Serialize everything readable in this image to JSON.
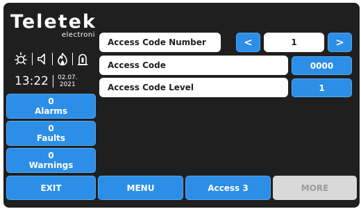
{
  "brand": {
    "name": "Teletek",
    "subtitle": "electroni"
  },
  "status_icons": [
    "sun-icon",
    "speaker-icon",
    "flame-icon",
    "siren-icon"
  ],
  "clock": {
    "time": "13:22",
    "date_line1": "02.07.",
    "date_line2": "2021"
  },
  "counters": [
    {
      "count": "0",
      "label": "Alarms"
    },
    {
      "count": "0",
      "label": "Faults"
    },
    {
      "count": "0",
      "label": "Warnings"
    }
  ],
  "fields": {
    "code_number": {
      "label": "Access Code Number",
      "value": "1",
      "prev": "<",
      "next": ">"
    },
    "code": {
      "label": "Access Code",
      "value": "0000"
    },
    "code_level": {
      "label": "Access Code Level",
      "value": "1"
    }
  },
  "footer": {
    "exit": "EXIT",
    "menu": "MENU",
    "access": "Access 3",
    "more": "MORE"
  },
  "colors": {
    "accent": "#2c8ee6",
    "background": "#1f1f1f",
    "disabled": "#d9d9d9"
  }
}
